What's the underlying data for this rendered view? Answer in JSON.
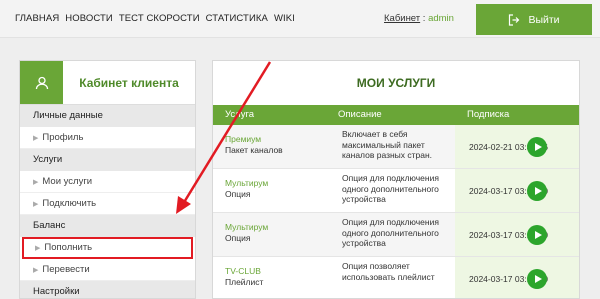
{
  "nav": {
    "items": [
      "ГЛАВНАЯ",
      "НОВОСТИ",
      "ТЕСТ СКОРОСТИ",
      "СТАТИСТИКА",
      "WIKI"
    ],
    "cabinet_label": "Кабинет",
    "separator": " : ",
    "username": "admin",
    "logout_label": "Выйти"
  },
  "sidebar": {
    "title": "Кабинет клиента",
    "groups": [
      {
        "label": "Личные данные",
        "items": [
          "Профиль"
        ]
      },
      {
        "label": "Услуги",
        "items": [
          "Мои услуги",
          "Подключить"
        ]
      },
      {
        "label": "Баланс",
        "items": [
          "Пополнить",
          "Перевести"
        ]
      },
      {
        "label": "Настройки",
        "items": []
      }
    ]
  },
  "main": {
    "title": "МОИ УСЛУГИ",
    "columns": [
      "Услуга",
      "Описание",
      "Подписка"
    ],
    "rows": [
      {
        "service": "Премиум",
        "kind": "Пакет каналов",
        "description": "Включает в себя максимальный пакет каналов разных стран.",
        "date": "2024-02-21 03:35:46"
      },
      {
        "service": "Мультирум",
        "kind": "Опция",
        "description": "Опция для подключения одного дополнительного устройства",
        "date": "2024-03-17 03:16:10"
      },
      {
        "service": "Мультирум",
        "kind": "Опция",
        "description": "Опция для подключения одного дополнительного устройства",
        "date": "2024-03-17 03:16:10"
      },
      {
        "service": "TV-CLUB",
        "kind": "Плейлист",
        "description": "Опция позволяет использовать плейлист",
        "date": "2024-03-17 03:16:10"
      }
    ]
  },
  "colors": {
    "accent": "#6aa637",
    "highlight": "#e21b23",
    "play": "#2ca52c"
  },
  "icons": {
    "logout": "logout-icon",
    "avatar": "user-icon",
    "play": "play-icon"
  }
}
